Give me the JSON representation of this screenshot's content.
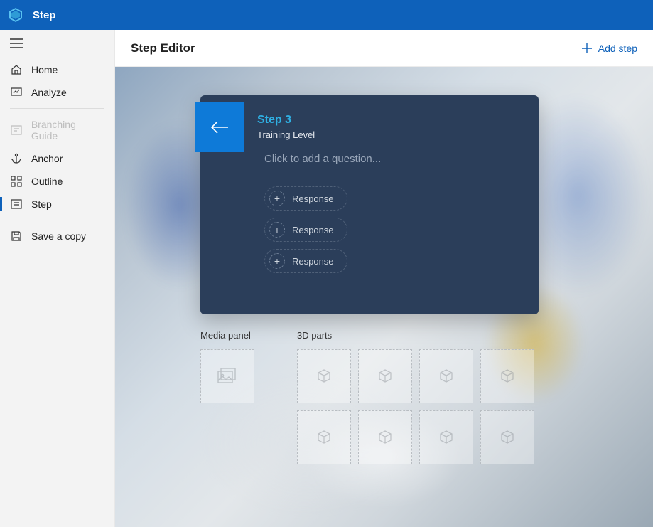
{
  "titlebar": {
    "app_name": "Step"
  },
  "sidebar": {
    "items": [
      {
        "label": "Home"
      },
      {
        "label": "Analyze"
      },
      {
        "label": "Branching Guide"
      },
      {
        "label": "Anchor"
      },
      {
        "label": "Outline"
      },
      {
        "label": "Step"
      },
      {
        "label": "Save a copy"
      }
    ]
  },
  "toolbar": {
    "title": "Step Editor",
    "add_label": "Add step"
  },
  "card": {
    "step_title": "Step 3",
    "step_subtitle": "Training Level",
    "question_placeholder": "Click to add a question...",
    "responses": [
      "Response",
      "Response",
      "Response"
    ]
  },
  "panels": {
    "media_label": "Media panel",
    "parts_label": "3D parts"
  }
}
